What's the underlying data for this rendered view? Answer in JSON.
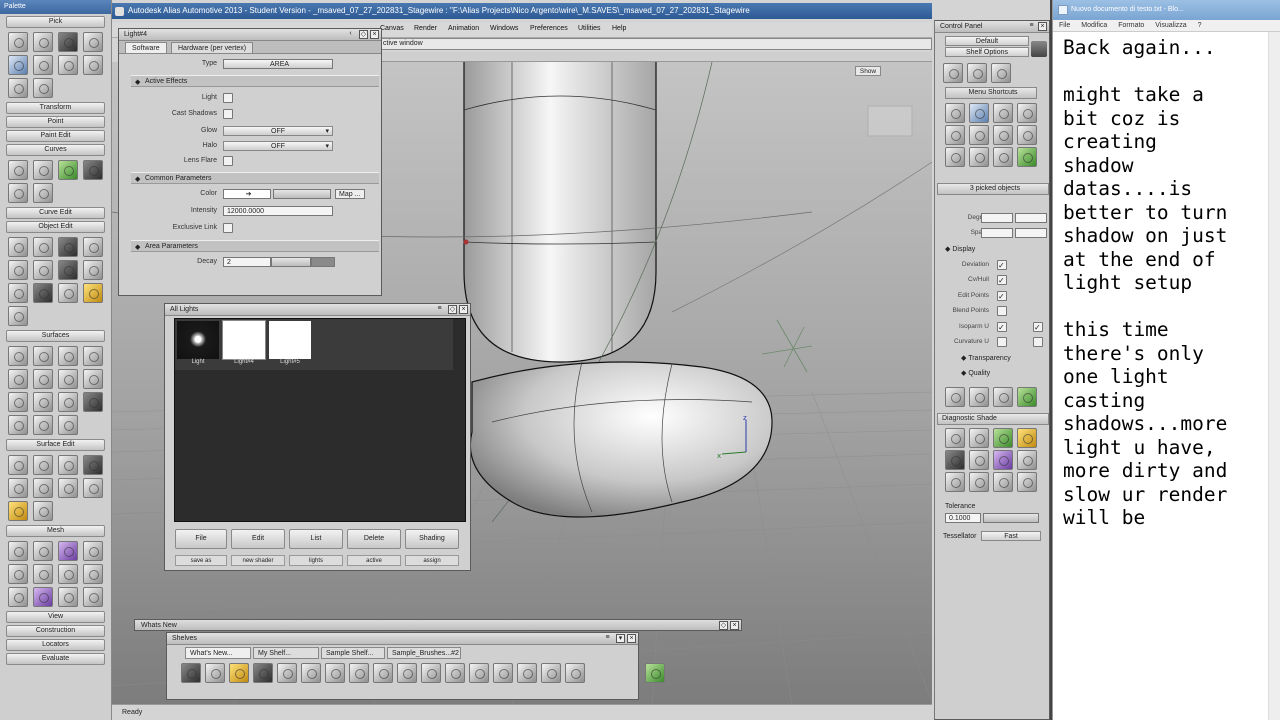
{
  "window": {
    "title": "Autodesk Alias Automotive 2013 - Student Version - _msaved_07_27_202831_Stagewire : \"F:\\Alias Projects\\Nico Argento\\wire\\_M.SAVES\\_msaved_07_27_202831_Stagewire"
  },
  "menubar": [
    "Canvas",
    "Render",
    "Animation",
    "Windows",
    "Preferences",
    "Utilities",
    "Help"
  ],
  "toolbar": {
    "context_text": "ctive window"
  },
  "palette": {
    "title": "Palette",
    "sections": [
      "Pick",
      "Transform",
      "Point",
      "Paint Edit",
      "Curves",
      "Curve Edit",
      "Object Edit",
      "Surfaces",
      "Surface Edit",
      "Mesh",
      "View",
      "Construction",
      "Locators",
      "Evaluate"
    ]
  },
  "light_editor": {
    "title": "Light#4",
    "tabs": [
      "Software",
      "Hardware (per vertex)"
    ],
    "type_label": "Type",
    "type_value": "AREA",
    "sections": {
      "active_effects": "Active Effects",
      "common": "Common Parameters",
      "area": "Area Parameters"
    },
    "light_label": "Light",
    "cast_shadows_label": "Cast Shadows",
    "glow_label": "Glow",
    "glow_value": "OFF",
    "halo_label": "Halo",
    "halo_value": "OFF",
    "lens_flare_label": "Lens Flare",
    "color_label": "Color",
    "map_button": "Map ...",
    "intensity_label": "Intensity",
    "intensity_value": "12000.0000",
    "exclusive_label": "Exclusive Link",
    "decay_label": "Decay",
    "decay_value": "2"
  },
  "all_lights": {
    "title": "All Lights",
    "thumbnails": [
      "Light",
      "Light#4",
      "Light#5"
    ],
    "buttons": [
      "File",
      "Edit",
      "List",
      "Delete",
      "Shading"
    ],
    "subbuttons": [
      "save as",
      "new shader",
      "lights",
      "active",
      "assign"
    ]
  },
  "control_panel": {
    "title": "Control Panel",
    "preset": "Default",
    "shelf_options": "Shelf Options",
    "menu_shortcuts": "Menu Shortcuts",
    "picked": "3 picked objects",
    "degree_label": "Degree",
    "spans_label": "Spans",
    "display_label": "Display",
    "display_rows": [
      "Deviation",
      "Cv/Hull",
      "Edit Points",
      "Blend Points",
      "Isoparm U",
      "Curvature U"
    ],
    "transparency": "Transparency",
    "quality": "Quality",
    "diagnostic": "Diagnostic Shade",
    "tolerance_label": "Tolerance",
    "tolerance_value": "0.1000",
    "tessellator_label": "Tessellator",
    "tessellator_value": "Fast"
  },
  "view_buttons": {
    "show": "Show"
  },
  "whats_new": {
    "title": "Whats New"
  },
  "shelves": {
    "title": "Shelves",
    "tabs": [
      "What's New...",
      "My Shelf...",
      "Sample Shelf...",
      "Sample_Brushes...#2"
    ]
  },
  "status": {
    "text": "Ready"
  },
  "notepad": {
    "title": "Nuovo documento di testo.txt - Blo...",
    "menu": [
      "File",
      "Modifica",
      "Formato",
      "Visualizza",
      "?"
    ],
    "text": "Back again...\n\nmight take a\nbit coz is\ncreating\nshadow\ndatas....is\nbetter to turn\nshadow on just\nat the end of\nlight setup\n\nthis time\nthere's only\none light\ncasting\nshadows...more\nlight u have,\nmore dirty and\nslow ur render\nwill be"
  },
  "colors": {
    "title_blue": "#3c679f",
    "panel_gray": "#d0d0d0",
    "viewport_gray": "#a2a2a2"
  }
}
